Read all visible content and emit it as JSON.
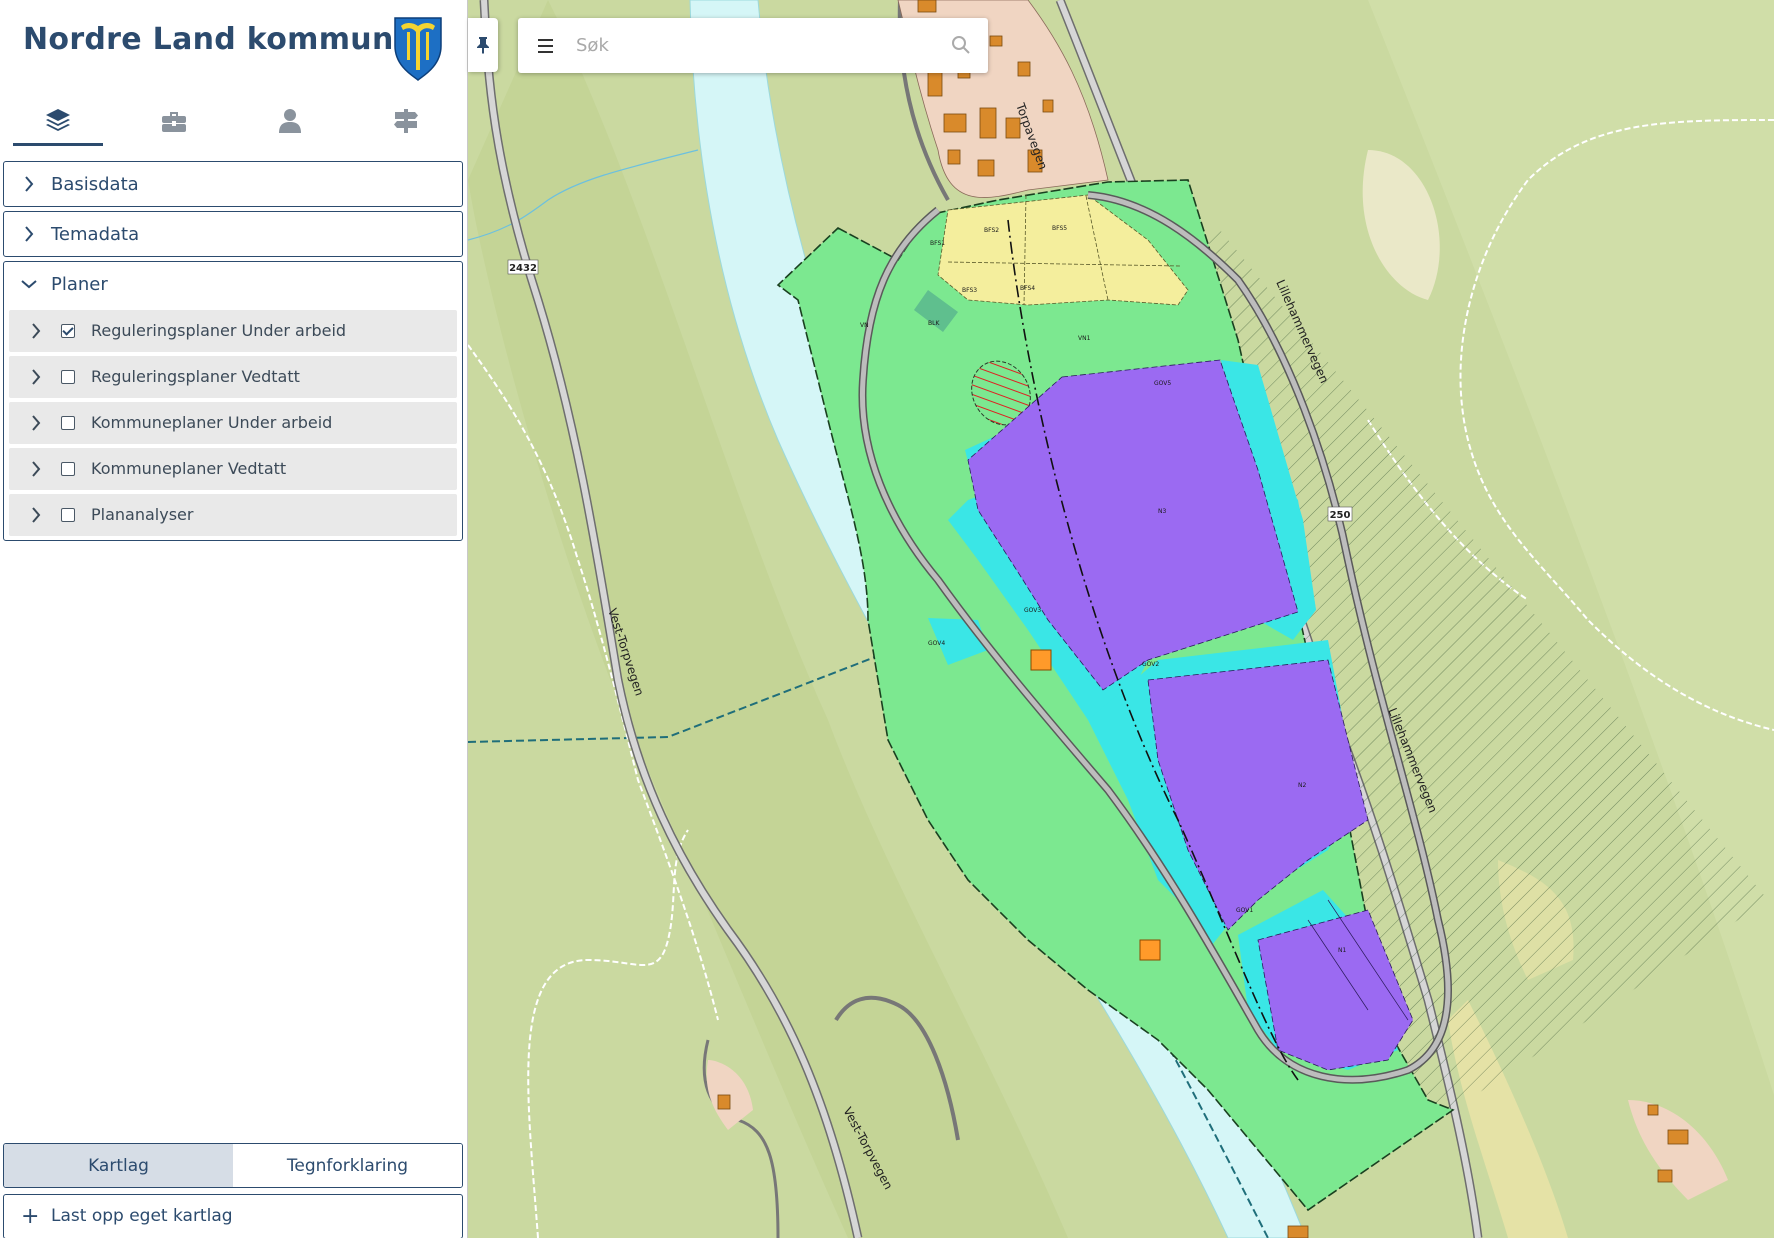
{
  "brand": {
    "title": "Nordre Land kommune",
    "coat_of_arms": "coat-of-arms"
  },
  "tabs": [
    {
      "icon": "layers-icon",
      "active": true
    },
    {
      "icon": "toolbox-icon",
      "active": false
    },
    {
      "icon": "person-icon",
      "active": false
    },
    {
      "icon": "signpost-icon",
      "active": false
    }
  ],
  "sections": {
    "basisdata": {
      "label": "Basisdata",
      "expanded": false
    },
    "temadata": {
      "label": "Temadata",
      "expanded": false
    },
    "planer": {
      "label": "Planer",
      "expanded": true,
      "items": [
        {
          "label": "Reguleringsplaner Under arbeid",
          "checked": true
        },
        {
          "label": "Reguleringsplaner Vedtatt",
          "checked": false
        },
        {
          "label": "Kommuneplaner Under arbeid",
          "checked": false
        },
        {
          "label": "Kommuneplaner Vedtatt",
          "checked": false
        },
        {
          "label": "Plananalyser",
          "checked": false
        }
      ]
    }
  },
  "bottom_tabs": {
    "kartlag": "Kartlag",
    "tegnforklaring": "Tegnforklaring",
    "active": "Kartlag"
  },
  "upload": {
    "label": "Last opp eget kartlag"
  },
  "search": {
    "placeholder": "Søk"
  },
  "map": {
    "road_numbers": {
      "west": "2432",
      "east": "250"
    },
    "road_names": {
      "vest_torpvegen": "Vest-Torpvegen",
      "torpavegen": "Torpavegen",
      "lillehammervegen": "Lillehammervegen"
    },
    "zone_labels": {
      "vn": "VN",
      "vn1": "VN1",
      "bfs1": "BFS1",
      "bfs2": "BFS2",
      "bfs3": "BFS3",
      "bfs4": "BFS4",
      "bfs5": "BFS5",
      "blk": "BLK",
      "gov1": "GOV1",
      "gov2": "GOV2",
      "gov3": "GOV3",
      "gov4": "GOV4",
      "gov5": "GOV5",
      "n1": "N1",
      "n2": "N2",
      "n3": "N3"
    },
    "colors": {
      "terrain": "#cad9a0",
      "river": "#d5f6f7",
      "plan_green": "#7ce890",
      "industry_purple": "#9b6af2",
      "gov_cyan": "#3ae6e6",
      "residential_yellow": "#f4ee9d",
      "housing_area": "#f0d5c2"
    }
  }
}
